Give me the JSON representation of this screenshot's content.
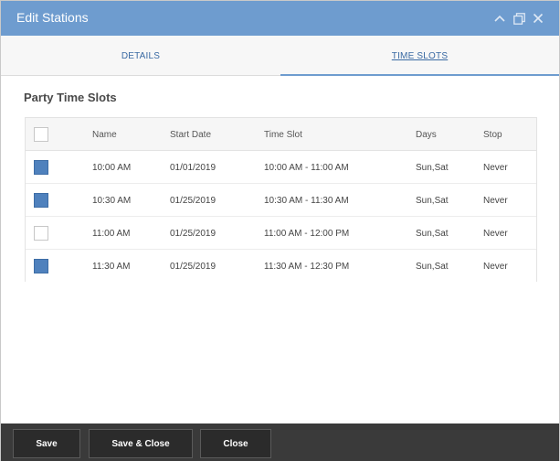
{
  "window": {
    "title": "Edit Stations",
    "accent_color": "#6e9ccf"
  },
  "tabs": [
    {
      "label": "DETAILS",
      "active": false
    },
    {
      "label": "TIME SLOTS",
      "active": true
    }
  ],
  "section": {
    "title": "Party Time Slots"
  },
  "table": {
    "columns": [
      "Name",
      "Start Date",
      "Time Slot",
      "Days",
      "Stop"
    ],
    "header_checked": false,
    "rows": [
      {
        "checked": true,
        "name": "10:00 AM",
        "start_date": "01/01/2019",
        "time_slot": "10:00 AM - 11:00 AM",
        "days": "Sun,Sat",
        "stop": "Never"
      },
      {
        "checked": true,
        "name": "10:30 AM",
        "start_date": "01/25/2019",
        "time_slot": "10:30 AM - 11:30 AM",
        "days": "Sun,Sat",
        "stop": "Never"
      },
      {
        "checked": false,
        "name": "11:00 AM",
        "start_date": "01/25/2019",
        "time_slot": "11:00 AM - 12:00 PM",
        "days": "Sun,Sat",
        "stop": "Never"
      },
      {
        "checked": true,
        "name": "11:30 AM",
        "start_date": "01/25/2019",
        "time_slot": "11:30 AM - 12:30 PM",
        "days": "Sun,Sat",
        "stop": "Never"
      }
    ],
    "checked_color": "#4f81bd"
  },
  "footer": {
    "save_label": "Save",
    "save_close_label": "Save & Close",
    "close_label": "Close"
  },
  "icons": {
    "collapse": "chevron-up-icon",
    "restore": "restore-window-icon",
    "close": "close-icon"
  }
}
